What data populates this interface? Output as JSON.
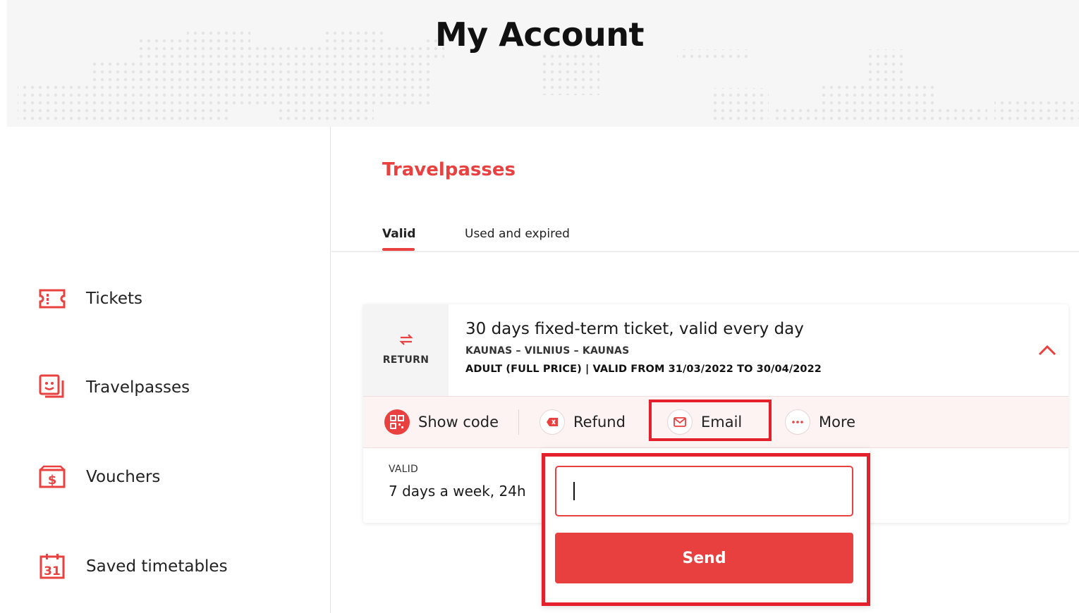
{
  "header": {
    "title": "My Account"
  },
  "sidebar": {
    "items": [
      {
        "label": "Tickets",
        "icon": "ticket-icon"
      },
      {
        "label": "Travelpasses",
        "icon": "travelpass-icon"
      },
      {
        "label": "Vouchers",
        "icon": "voucher-icon"
      },
      {
        "label": "Saved timetables",
        "icon": "calendar-icon",
        "icon_text": "31"
      }
    ]
  },
  "main": {
    "section_title": "Travelpasses",
    "tabs": [
      {
        "label": "Valid",
        "active": true
      },
      {
        "label": "Used and expired",
        "active": false
      }
    ],
    "ticket": {
      "type_label": "RETURN",
      "title": "30 days fixed-term ticket, valid every day",
      "route": "KAUNAS – VILNIUS – KAUNAS",
      "detail": "ADULT (FULL PRICE) | VALID FROM 31/03/2022 TO 30/04/2022",
      "valid_label": "VALID",
      "valid_value": "7 days a week, 24h",
      "actions": [
        {
          "label": "Show code",
          "icon": "qr-code-icon"
        },
        {
          "label": "Refund",
          "icon": "refund-icon"
        },
        {
          "label": "Email",
          "icon": "email-icon"
        },
        {
          "label": "More",
          "icon": "more-icon"
        }
      ]
    },
    "email_popup": {
      "input_value": "",
      "send_label": "Send"
    }
  },
  "colors": {
    "accent": "#e8413f",
    "highlight": "#e3202b",
    "header_bg": "#f6f6f7",
    "action_bar_bg": "#fdf3f3"
  }
}
